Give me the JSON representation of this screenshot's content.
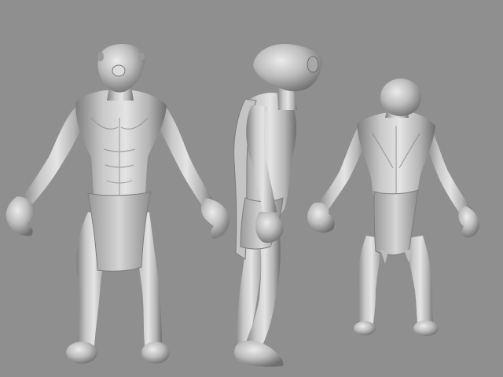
{
  "scene": {
    "subject": "humanoid-creature-turnaround",
    "views": [
      "front",
      "side",
      "back"
    ],
    "background_color": "#8f8f8f",
    "material_color": "#b9b9b9"
  }
}
